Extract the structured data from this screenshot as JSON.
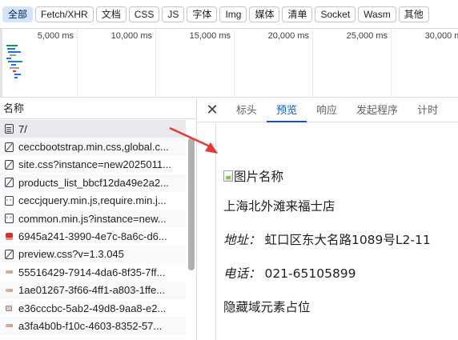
{
  "filters": [
    {
      "label": "全部",
      "active": true
    },
    {
      "label": "Fetch/XHR",
      "active": false
    },
    {
      "label": "文档",
      "active": false
    },
    {
      "label": "CSS",
      "active": false
    },
    {
      "label": "JS",
      "active": false
    },
    {
      "label": "字体",
      "active": false
    },
    {
      "label": "Img",
      "active": false
    },
    {
      "label": "媒体",
      "active": false
    },
    {
      "label": "清单",
      "active": false
    },
    {
      "label": "Socket",
      "active": false
    },
    {
      "label": "Wasm",
      "active": false
    },
    {
      "label": "其他",
      "active": false
    }
  ],
  "overview": {
    "ticks": [
      "5,000 ms",
      "10,000 ms",
      "15,000 ms",
      "20,000 ms",
      "25,000 ms",
      "30,000 ms"
    ]
  },
  "list": {
    "header": "名称",
    "requests": [
      {
        "name": "7/",
        "icon": "document-icon"
      },
      {
        "name": "ceccbootstrap.min.css,global.c...",
        "icon": "stylesheet-icon"
      },
      {
        "name": "site.css?instance=new2025011...",
        "icon": "stylesheet-icon"
      },
      {
        "name": "products_list_bbcf12da49e2a2...",
        "icon": "stylesheet-icon"
      },
      {
        "name": "ceccjquery.min.js,require.min.j...",
        "icon": "script-icon"
      },
      {
        "name": "common.min.js?instance=new...",
        "icon": "script-icon"
      },
      {
        "name": "6945a241-3990-4e7c-8a6c-d6...",
        "icon": "image-icon"
      },
      {
        "name": "preview.css?v=1.3.045",
        "icon": "stylesheet-icon"
      },
      {
        "name": "55516429-7914-4da6-8f35-7ff...",
        "icon": "image-icon"
      },
      {
        "name": "1ae01267-3f66-4ff1-a803-1ffe...",
        "icon": "image-icon"
      },
      {
        "name": "e36cccbc-5ab2-49d8-9aa8-e2...",
        "icon": "image-icon"
      },
      {
        "name": "a3fa4b0b-f10c-4603-8352-57...",
        "icon": "image-icon"
      }
    ]
  },
  "detail": {
    "tabs": [
      {
        "label": "标头",
        "active": false
      },
      {
        "label": "预览",
        "active": true
      },
      {
        "label": "响应",
        "active": false
      },
      {
        "label": "发起程序",
        "active": false
      },
      {
        "label": "计时",
        "active": false
      }
    ],
    "preview": {
      "img_alt": "图片名称",
      "store_name": "上海北外滩来福士店",
      "address_label": "地址：",
      "address_value": "虹口区东大名路1089号L2-11",
      "phone_label": "电话：",
      "phone_value": "021-65105899",
      "hidden_text": "隐藏域元素占位"
    }
  },
  "colors": {
    "accent": "#0b57d0",
    "active_chip_bg": "#d3e3fd",
    "annotation_arrow": "#e53935"
  }
}
